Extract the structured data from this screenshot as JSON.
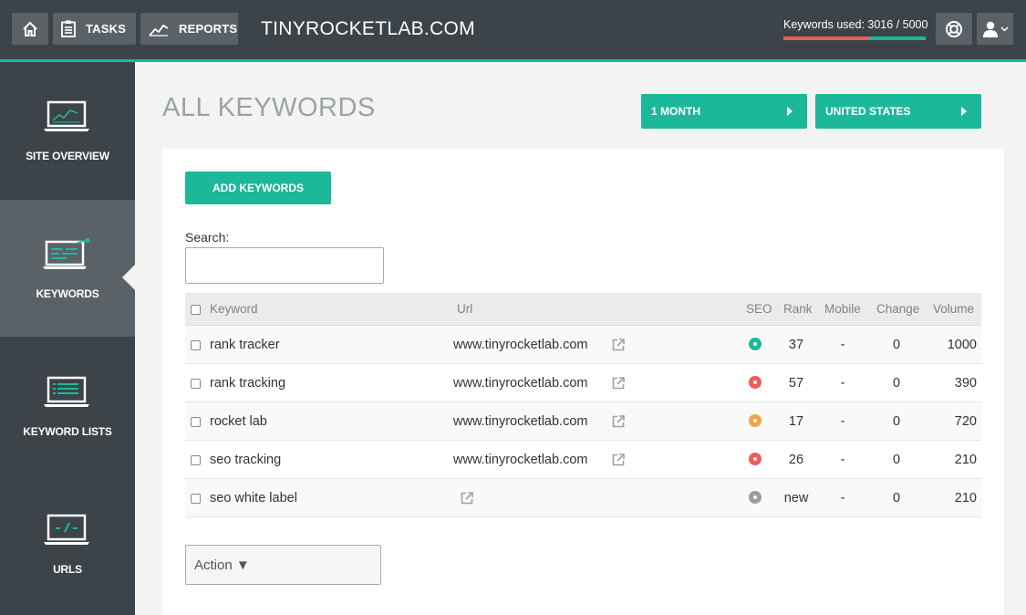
{
  "header": {
    "tasks_label": "TASKS",
    "reports_label": "REPORTS",
    "site_title": "TINYROCKETLAB.COM",
    "keywords_used_text": "Keywords used: 3016 / 5000",
    "keywords_used": 3016,
    "keywords_total": 5000,
    "accent_color": "#1bb99a",
    "alert_color": "#f05b57"
  },
  "sidebar": {
    "items": [
      {
        "label": "SITE OVERVIEW",
        "icon": "chart-laptop-icon"
      },
      {
        "label": "KEYWORDS",
        "icon": "keywords-laptop-icon",
        "active": true
      },
      {
        "label": "KEYWORD LISTS",
        "icon": "list-laptop-icon"
      },
      {
        "label": "URLS",
        "icon": "url-laptop-icon"
      }
    ]
  },
  "main": {
    "title": "ALL KEYWORDS",
    "period_filter": "1 MONTH",
    "country_filter": "UNITED STATES",
    "add_button": "ADD KEYWORDS",
    "search_label": "Search:",
    "action_label": "Action ▼"
  },
  "table": {
    "headers": {
      "keyword": "Keyword",
      "url": "Url",
      "seo": "SEO",
      "rank": "Rank",
      "mobile": "Mobile",
      "change": "Change",
      "volume": "Volume"
    },
    "rows": [
      {
        "keyword": "rank tracker",
        "url": "www.tinyrocketlab.com",
        "seo": "#1bb99a",
        "rank": "37",
        "mobile": "-",
        "change": "0",
        "volume": "1000"
      },
      {
        "keyword": "rank tracking",
        "url": "www.tinyrocketlab.com",
        "seo": "#f05b57",
        "rank": "57",
        "mobile": "-",
        "change": "0",
        "volume": "390"
      },
      {
        "keyword": "rocket lab",
        "url": "www.tinyrocketlab.com",
        "seo": "#f5a346",
        "rank": "17",
        "mobile": "-",
        "change": "0",
        "volume": "720"
      },
      {
        "keyword": "seo tracking",
        "url": "www.tinyrocketlab.com",
        "seo": "#f05b57",
        "rank": "26",
        "mobile": "-",
        "change": "0",
        "volume": "210"
      },
      {
        "keyword": "seo white label",
        "url": "",
        "seo": "#95a0a3",
        "rank": "new",
        "mobile": "-",
        "change": "0",
        "volume": "210"
      }
    ]
  }
}
